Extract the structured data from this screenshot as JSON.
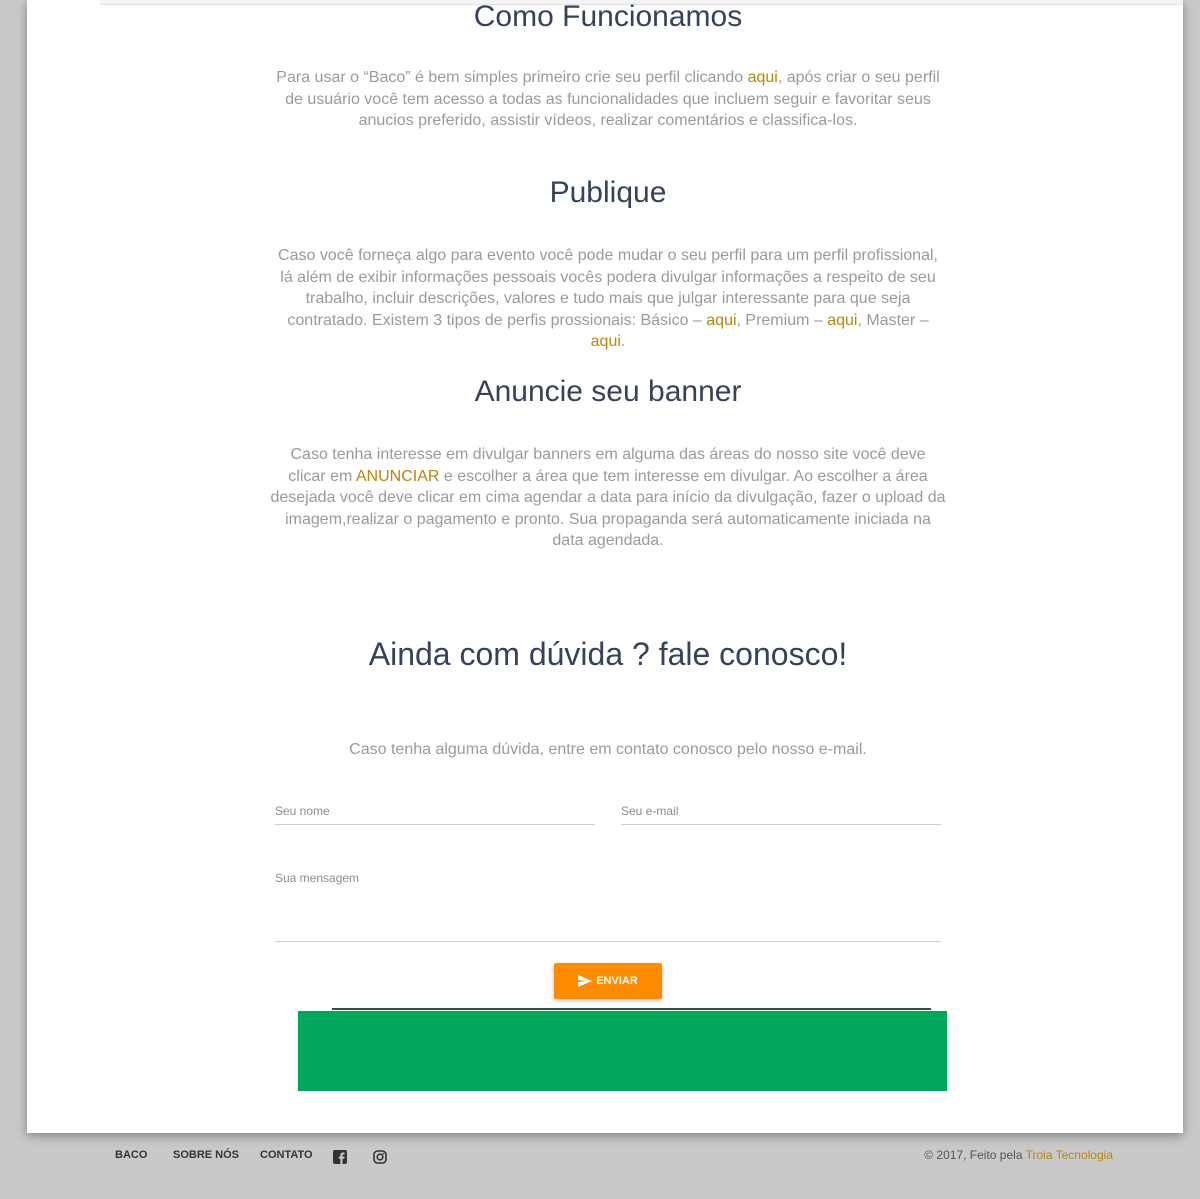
{
  "sections": [
    {
      "title": "Como Funcionamos",
      "parts": [
        "Para usar o “Baco” é bem simples primeiro crie seu perfil clicando ",
        "aqui",
        ", após criar o seu perfil de usuário você tem acesso a todas as funcionalidades que incluem seguir e favoritar seus anucios preferido, assistir vídeos, realizar comentários e classifica-los."
      ]
    },
    {
      "title": "Publique",
      "parts": [
        "Caso você forneça algo para evento você pode mudar o seu perfil para um perfil profissional, lá além de exibir informações pessoais vocês podera divulgar informações a respeito de seu trabalho, incluir descrições, valores e tudo mais que julgar interessante para que seja contratado. Existem 3 tipos de perfis prossionais: Básico – ",
        "aqui",
        ", Premium – ",
        "aqui",
        ", Master – ",
        "aqui",
        "."
      ]
    },
    {
      "title": "Anuncie seu banner",
      "parts": [
        "Caso tenha interesse em divulgar banners em alguma das áreas do nosso site você deve clicar em ",
        "ANUNCIAR",
        " e escolher a área que tem interesse em divulgar. Ao escolher a área desejada você deve clicar em cima agendar a data para início da divulgação, fazer o upload da imagem,realizar o pagamento e pronto. Sua propaganda será automaticamente iniciada na data agendada."
      ]
    }
  ],
  "contact": {
    "title": "Ainda com dúvida ? fale conosco!",
    "subtitle": "Caso tenha alguma dúvida, entre em contato conosco pelo nosso e-mail.",
    "name_placeholder": "Seu nome",
    "email_placeholder": "Seu e-mail",
    "message_placeholder": "Sua mensagem",
    "send_label": "ENVIAR"
  },
  "footer": {
    "links": [
      "BACO",
      "SOBRE NÓS",
      "CONTATO"
    ],
    "icons": [
      "facebook-icon",
      "instagram-icon"
    ],
    "copyright_prefix": "© 2017, Feito pela ",
    "copyright_brand": "Troia Tecnologia"
  },
  "colors": {
    "accent": "#ff8c00",
    "link": "#b8860b",
    "title": "#36425a",
    "banner": "#00a65a"
  }
}
